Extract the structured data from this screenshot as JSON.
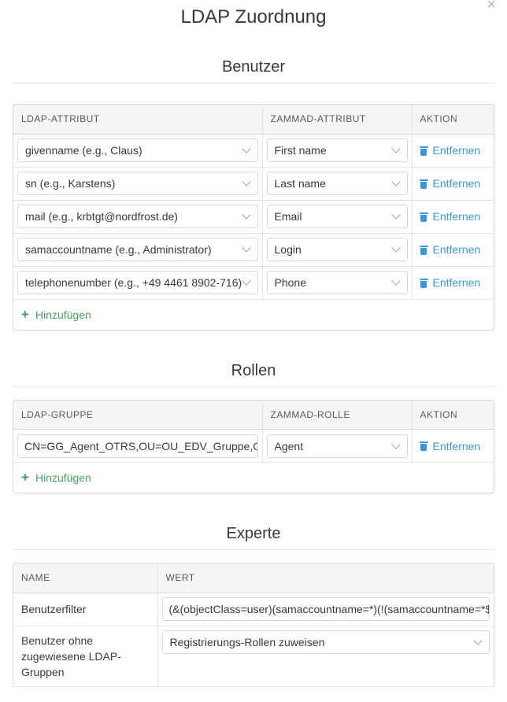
{
  "title": "LDAP Zuordnung",
  "close_icon": "×",
  "users": {
    "section_title": "Benutzer",
    "headers": [
      "LDAP-ATTRIBUT",
      "ZAMMAD-ATTRIBUT",
      "AKTION"
    ],
    "rows": [
      {
        "ldap": "givenname (e.g., Claus)",
        "zammad": "First name",
        "action": "Entfernen"
      },
      {
        "ldap": "sn (e.g., Karstens)",
        "zammad": "Last name",
        "action": "Entfernen"
      },
      {
        "ldap": "mail (e.g., krbtgt@nordfrost.de)",
        "zammad": "Email",
        "action": "Entfernen"
      },
      {
        "ldap": "samaccountname (e.g., Administrator)",
        "zammad": "Login",
        "action": "Entfernen"
      },
      {
        "ldap": "telephonenumber (e.g., +49 4461 8902-716)",
        "zammad": "Phone",
        "action": "Entfernen"
      }
    ],
    "add_label": "Hinzufügen"
  },
  "roles": {
    "section_title": "Rollen",
    "headers": [
      "LDAP-GRUPPE",
      "ZAMMAD-ROLLE",
      "AKTION"
    ],
    "rows": [
      {
        "ldap": "CN=GG_Agent_OTRS,OU=OU_EDV_Gruppe,OU=OU_Gruppen",
        "zammad": "Agent",
        "action": "Entfernen"
      }
    ],
    "add_label": "Hinzufügen"
  },
  "expert": {
    "section_title": "Experte",
    "headers": [
      "NAME",
      "WERT"
    ],
    "filter_label": "Benutzerfilter",
    "filter_value": "(&(objectClass=user)(samaccountname=*)(!(samaccountname=*$)))",
    "unassigned_label": "Benutzer ohne zugewiesene LDAP-Gruppen",
    "unassigned_value": "Registrierungs-Rollen zuweisen"
  }
}
